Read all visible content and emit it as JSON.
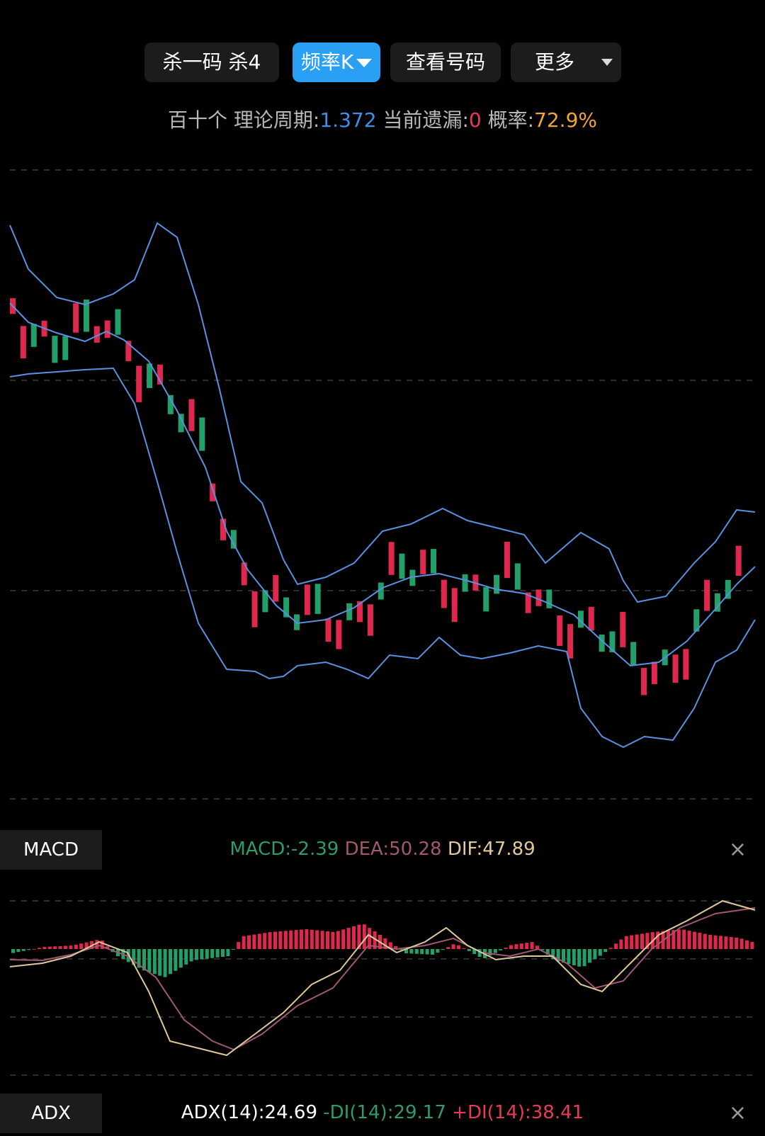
{
  "toolbar": {
    "kill_label": "杀一码 杀4",
    "freq_label": "频率K",
    "view_label": "查看号码",
    "more_label": "更多"
  },
  "info": {
    "position": "百十个",
    "period_label": "理论周期:",
    "period_value": "1.372",
    "miss_label": "当前遗漏:",
    "miss_value": "0",
    "prob_label": "概率:",
    "prob_value": "72.9%"
  },
  "macd": {
    "tag": "MACD",
    "macd_label": "MACD:",
    "macd_value": "-2.39",
    "dea_label": "DEA:",
    "dea_value": "50.28",
    "dif_label": "DIF:",
    "dif_value": "47.89",
    "close": "×"
  },
  "adx": {
    "tag": "ADX",
    "adx_label": "ADX(14):",
    "adx_value": "24.69",
    "mdi_label": "-DI(14):",
    "mdi_value": "29.17",
    "pdi_label": "+DI(14):",
    "pdi_value": "38.41",
    "close": "×"
  },
  "colors": {
    "up": "#e0284e",
    "down": "#23a06a",
    "band": "#5b8fe0",
    "dif": "#e0c89a",
    "dea": "#a05870",
    "grid": "#3a3a3a"
  }
}
